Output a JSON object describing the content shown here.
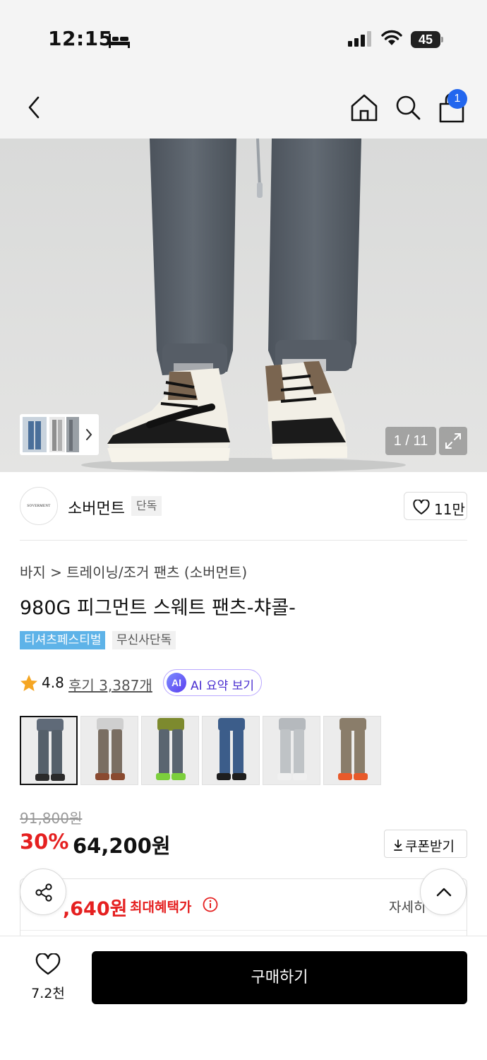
{
  "status_bar": {
    "time": "12:15",
    "battery": "45"
  },
  "nav": {
    "cart_badge": "1"
  },
  "gallery": {
    "counter": "1 / 11"
  },
  "brand": {
    "logo_text": "SOVERMENT",
    "name": "소버먼트",
    "tag": "단독",
    "likes": "11만"
  },
  "product": {
    "breadcrumb": "바지 > 트레이닝/조거 팬츠 (소버먼트)",
    "title": "980G 피그먼트 스웨트 팬츠-챠콜-",
    "tags": [
      "티셔츠페스티벌",
      "무신사단독"
    ],
    "rating": "4.8",
    "reviews_label": "후기 3,387개",
    "ai_badge": "AI",
    "ai_summary_label": "AI 요약 보기",
    "color_thumbs": [
      {
        "name": "charcoal",
        "pants": "#55606a",
        "top": "#5f6a78",
        "shoe": "#2a2a2a",
        "selected": true
      },
      {
        "name": "brown",
        "pants": "#7a6e62",
        "top": "#cfcfcf",
        "shoe": "#8a4a30",
        "selected": false
      },
      {
        "name": "green-grey",
        "pants": "#5a6570",
        "top": "#7d8a2e",
        "shoe": "#7ccf3c",
        "selected": false
      },
      {
        "name": "blue",
        "pants": "#3c5d8a",
        "top": "#3c5d8a",
        "shoe": "#1e1e1e",
        "selected": false
      },
      {
        "name": "light-grey",
        "pants": "#bfc3c6",
        "top": "#b5b9bd",
        "shoe": "#f0f0f0",
        "selected": false
      },
      {
        "name": "khaki",
        "pants": "#8a7d6a",
        "top": "#8a7d6a",
        "shoe": "#e85a2a",
        "selected": false
      }
    ],
    "original_price": "91,800원",
    "discount": "30%",
    "sale_price": "64,200원",
    "coupon_label": "쿠폰받기"
  },
  "benefit": {
    "max_price": ",640원",
    "label": "최대혜택가",
    "detail_label": "자세히"
  },
  "bottom_bar": {
    "like_count": "7.2천",
    "buy_label": "구매하기"
  },
  "colors": {
    "accent_red": "#e52020",
    "cart_badge_blue": "#2266ee",
    "fest_tag_blue": "#5eb3e8",
    "ai_purple": "#4a2fd0",
    "star_orange": "#f5a623"
  }
}
